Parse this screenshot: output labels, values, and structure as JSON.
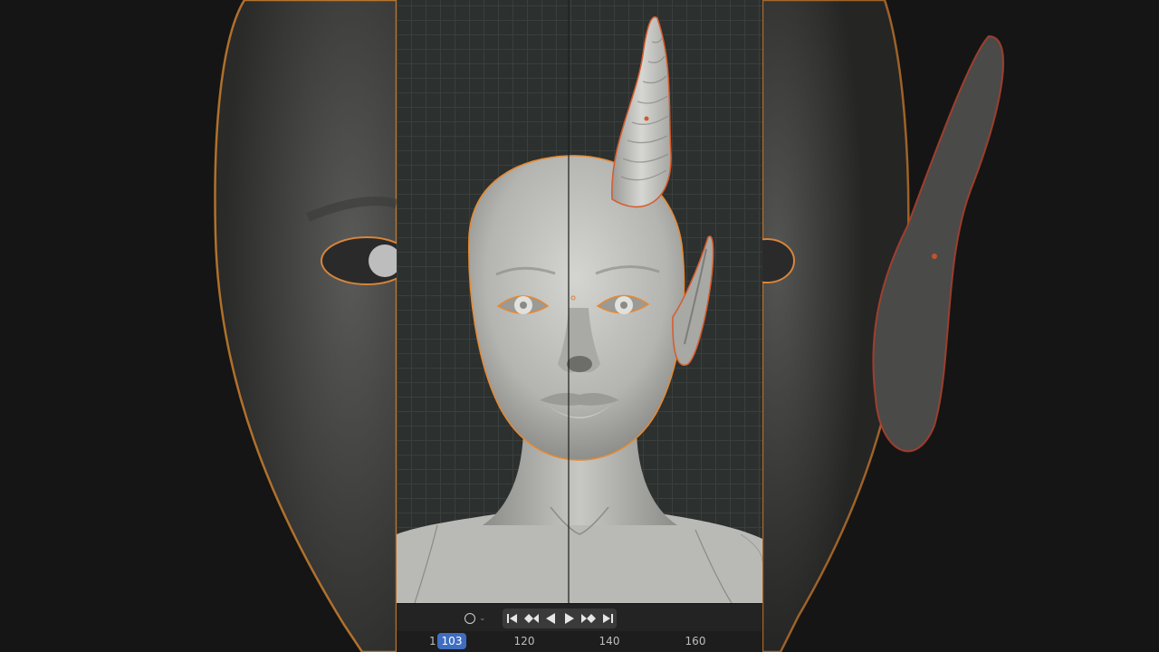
{
  "timeline": {
    "current_frame": "103",
    "partial_label": "1",
    "ticks": [
      "120",
      "140",
      "160"
    ]
  },
  "colors": {
    "selection_outline": "#e8892f",
    "active_outline": "#d85a2a",
    "current_frame_bg": "#3f6ec0",
    "viewport_bg": "#2c302f"
  },
  "icons": {
    "keying": "circle-icon",
    "jump_start": "jump-start-icon",
    "prev_keyframe": "prev-keyframe-icon",
    "play_reverse": "play-reverse-icon",
    "play": "play-icon",
    "next_keyframe": "next-keyframe-icon",
    "jump_end": "jump-end-icon"
  }
}
